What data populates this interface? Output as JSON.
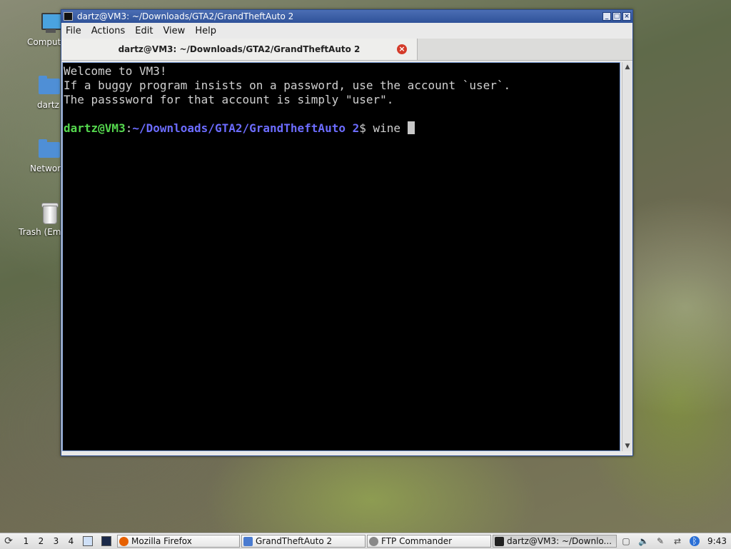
{
  "desktop": {
    "icons": [
      {
        "label": "Computer",
        "icon": "computer-icon"
      },
      {
        "label": "dartz",
        "icon": "home-folder-icon"
      },
      {
        "label": "Network",
        "icon": "network-folder-icon"
      },
      {
        "label": "Trash (Empty)",
        "icon": "trash-icon"
      }
    ]
  },
  "window": {
    "title": "dartz@VM3: ~/Downloads/GTA2/GrandTheftAuto 2",
    "menu": [
      "File",
      "Actions",
      "Edit",
      "View",
      "Help"
    ],
    "tab_title": "dartz@VM3: ~/Downloads/GTA2/GrandTheftAuto 2",
    "terminal": {
      "lines": [
        "Welcome to VM3!",
        "If a buggy program insists on a password, use the account `user`.",
        "The passsword for that account is simply \"user\"."
      ],
      "prompt_user_host": "dartz@VM3",
      "prompt_sep": ":",
      "prompt_path": "~/Downloads/GTA2/GrandTheftAuto 2",
      "prompt_symbol": "$ ",
      "command": "wine "
    }
  },
  "taskbar": {
    "workspaces": [
      "1",
      "2",
      "3",
      "4"
    ],
    "tasks": [
      {
        "label": "Mozilla Firefox",
        "color": "#e66000",
        "icon": "firefox-icon"
      },
      {
        "label": "GrandTheftAuto 2",
        "color": "#4a7bd0",
        "icon": "folder-icon"
      },
      {
        "label": "FTP Commander",
        "color": "#888888",
        "icon": "ftp-icon"
      },
      {
        "label": "dartz@VM3: ~/Downlo...",
        "color": "#222222",
        "icon": "terminal-icon"
      }
    ],
    "clock": "9:43"
  },
  "colors": {
    "titlebar": "#2f5299",
    "prompt_user": "#55d84e",
    "prompt_path": "#6c6cff",
    "tab_close": "#d43b2a"
  }
}
